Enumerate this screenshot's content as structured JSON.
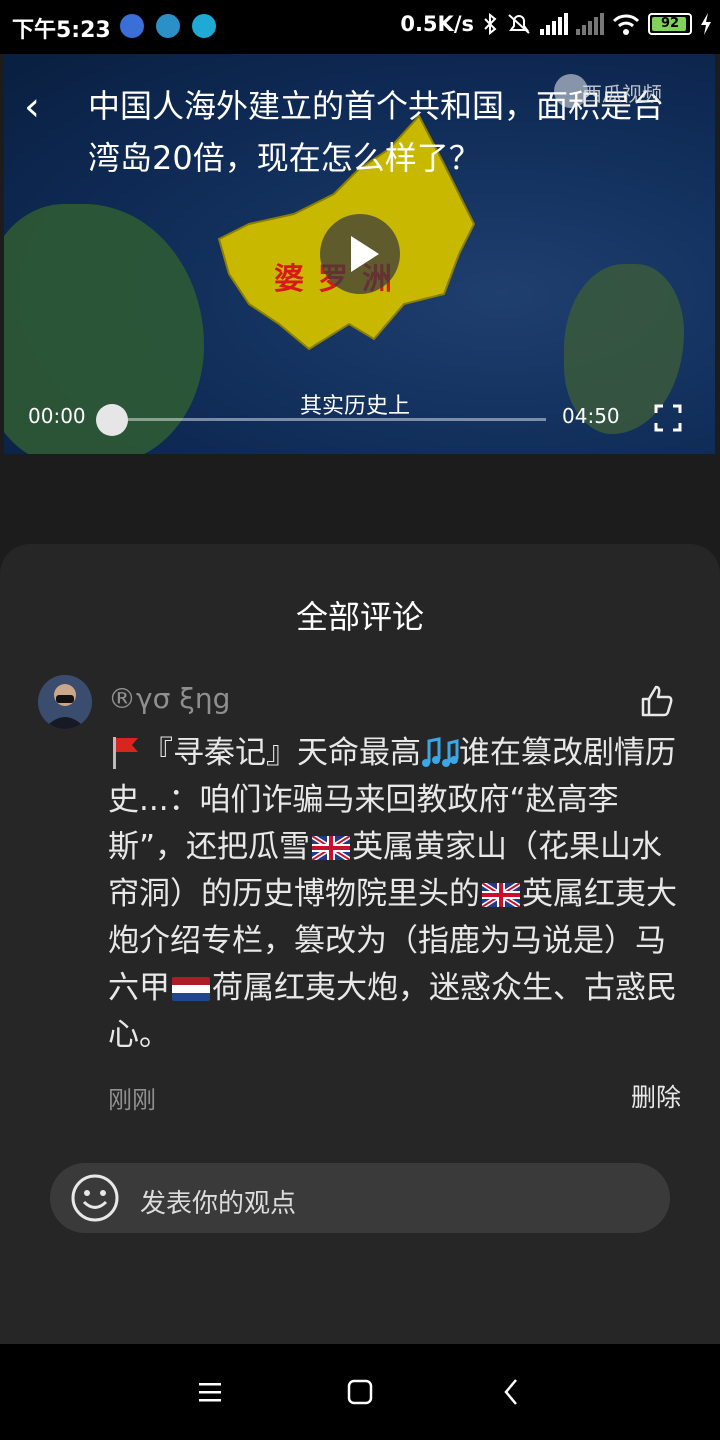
{
  "status_bar": {
    "time": "下午5:23",
    "network_speed": "0.5K/s",
    "battery": "92",
    "icons": [
      "app-notification-icon",
      "app-notification-icon",
      "app-notification-icon",
      "bluetooth-icon",
      "mute-icon",
      "signal-icon",
      "signal-icon",
      "wifi-icon",
      "battery-icon",
      "charging-icon"
    ]
  },
  "video": {
    "title": "中国人海外建立的首个共和国，面积是台湾岛20倍，现在怎么样了？",
    "brand": "西瓜视频",
    "map_label": "婆罗洲",
    "subtitle": "其实历史上",
    "time_current": "00:00",
    "time_total": "04:50",
    "progress": 0
  },
  "comments_sheet": {
    "title": "全部评论",
    "comments": [
      {
        "username": "®γσ ξηg",
        "segments": [
          "『寻秦记』天命最高",
          "谁在篡改剧情历史...：咱们诈骗马来回教政府“赵高李斯”，还把瓜雪",
          "英属黄家山（花果山水帘洞）的历史博物院里头的",
          "英属红夷大炮介绍专栏，篡改为（指鹿为马说是）马六甲",
          "荷属红夷大炮，迷惑众生、古惑民心。"
        ],
        "time": "刚刚",
        "delete_label": "删除"
      }
    ],
    "input_placeholder": "发表你的观点"
  },
  "colors": {
    "sheet_bg": "#262626",
    "page_bg": "#1c1c1c",
    "map_land": "#c9b800",
    "map_label": "#d61a1a",
    "muted_text": "#8f8f8f"
  }
}
